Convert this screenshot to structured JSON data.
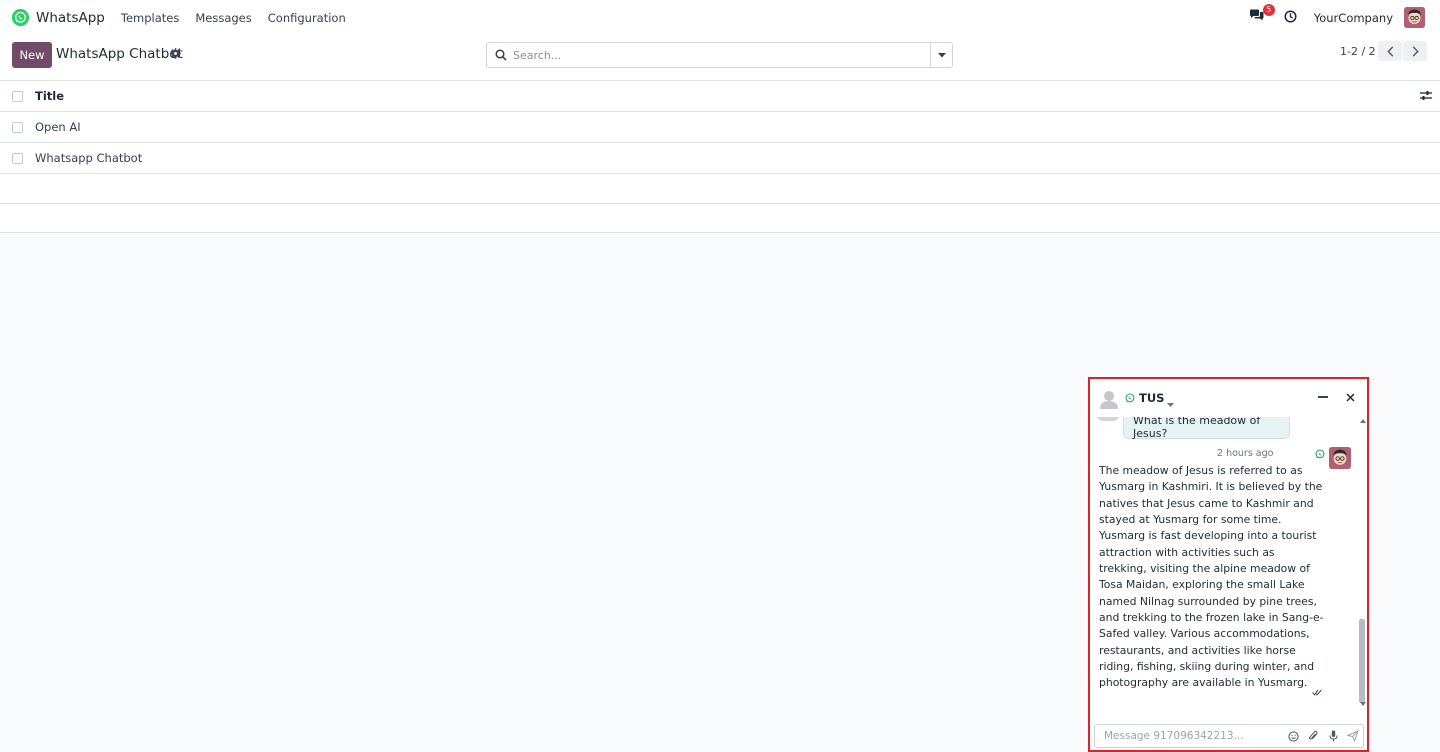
{
  "navbar": {
    "app_name": "WhatsApp",
    "menu": [
      "Templates",
      "Messages",
      "Configuration"
    ],
    "messages_badge": "5",
    "company": "YourCompany"
  },
  "control_panel": {
    "new_label": "New",
    "title": "WhatsApp Chatbot",
    "search_placeholder": "Search...",
    "pager": "1-2 / 2"
  },
  "list": {
    "column_title": "Title",
    "rows": [
      "Open AI",
      "Whatsapp Chatbot"
    ]
  },
  "chat": {
    "contact_name": "TUS",
    "incoming_message": "What is the meadow of Jesus?",
    "timestamp": "2 hours ago",
    "outgoing_message": "The meadow of Jesus is referred to as Yusmarg in Kashmiri. It is believed by the natives that Jesus came to Kashmir and stayed at Yusmarg for some time. Yusmarg is fast developing into a tourist attraction with activities such as trekking, visiting the alpine meadow of Tosa Maidan, exploring the small Lake named Nilnag surrounded by pine trees, and trekking to the frozen lake in Sang-e-Safed valley. Various accommodations, restaurants, and activities like horse riding, fishing, skiing during winter, and photography are available in Yusmarg.",
    "composer_placeholder": "Message 917096342213..."
  },
  "colors": {
    "brand_primary": "#714b67",
    "whatsapp_green": "#25d366",
    "badge_red": "#e0313d",
    "highlight_border": "#d9232e",
    "incoming_bubble": "#e6f2f3"
  },
  "icons": [
    "whatsapp-logo",
    "chat-bubbles-icon",
    "clock-icon",
    "gear-icon",
    "search-icon",
    "caret-down-icon",
    "chevron-left-icon",
    "chevron-right-icon",
    "sliders-icon",
    "minimize-icon",
    "close-icon",
    "emoji-icon",
    "paperclip-icon",
    "microphone-icon",
    "send-icon",
    "double-check-icon"
  ]
}
